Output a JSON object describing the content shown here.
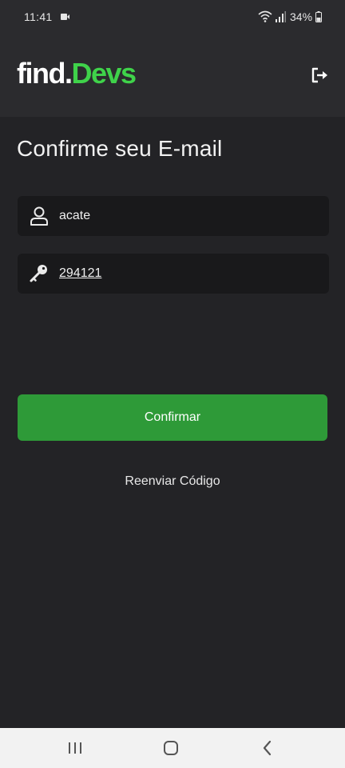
{
  "status_bar": {
    "time": "11:41",
    "battery": "34%",
    "icons": [
      "screen-record-icon",
      "wifi-icon",
      "signal-icon",
      "battery-icon"
    ]
  },
  "header": {
    "logo_part1": "find.",
    "logo_part2": "Devs",
    "logo_colors": {
      "part1": "#ffffff",
      "part2": "#3fd24a"
    },
    "logout_icon": "logout-icon"
  },
  "page": {
    "title": "Confirme seu E-mail"
  },
  "form": {
    "username": {
      "value": "acate",
      "icon": "user-icon"
    },
    "code": {
      "value": "294121",
      "icon": "key-icon"
    },
    "confirm_label": "Confirmar",
    "resend_label": "Reenviar Código"
  },
  "colors": {
    "accent": "#3fd24a",
    "button": "#2e9a38",
    "background": "#232326",
    "field_background": "#19191b"
  },
  "nav_bar": {
    "icons": [
      "recents-icon",
      "home-icon",
      "back-icon"
    ]
  }
}
